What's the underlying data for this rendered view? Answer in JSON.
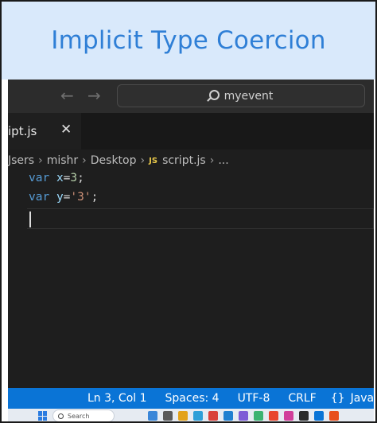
{
  "banner": {
    "title": "Implicit Type Coercion"
  },
  "titlebar": {
    "back_glyph": "←",
    "forward_glyph": "→",
    "search_text": "myevent"
  },
  "tab": {
    "label": "ipt.js",
    "close_glyph": "✕"
  },
  "breadcrumb": {
    "items": [
      "Jsers",
      "mishr",
      "Desktop"
    ],
    "file_badge": "JS",
    "file": "script.js",
    "tail": "..."
  },
  "editor": {
    "lines": [
      {
        "kw": "var",
        "name": "x",
        "op": "=",
        "value": "3",
        "end": ";"
      },
      {
        "kw": "var",
        "name": "y",
        "op": "=",
        "value": "'3'",
        "end": ";"
      }
    ]
  },
  "statusbar": {
    "position": "Ln 3, Col 1",
    "spaces": "Spaces: 4",
    "encoding": "UTF-8",
    "eol": "CRLF",
    "language_icon": "{}",
    "language": "JavaSc"
  },
  "taskbar": {
    "search_text": "Search",
    "app_colors": [
      "#3a86d8",
      "#5a5a5a",
      "#e3a21a",
      "#2d9fd8",
      "#d9413a",
      "#1f7fd0",
      "#7d5bd6",
      "#3cb371",
      "#e8452c",
      "#d13f9a",
      "#2a2a2a",
      "#0a74d6",
      "#e84e1b"
    ]
  },
  "colors": {
    "title": "#2f7fd6",
    "banner_bg": "#d9e9fb",
    "statusbar_bg": "#0a74d6",
    "keyword": "#569cd6",
    "variable": "#9cdcfe",
    "number": "#b5cea8",
    "string": "#ce9178"
  }
}
